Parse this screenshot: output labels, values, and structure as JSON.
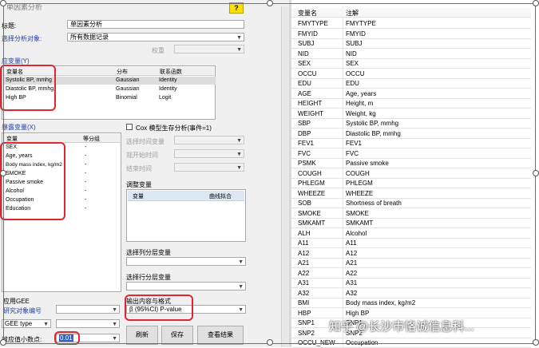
{
  "dialog": {
    "title": "单因素分析",
    "help_label": "?",
    "title_label": "标题:",
    "title_value": "单因素分析",
    "target_label": "选择分析对象:",
    "target_value": "所有数据记录",
    "weight_label": "权重",
    "dependent": {
      "label": "应变量(Y)",
      "headers": [
        "变量名",
        "分布",
        "联系函数"
      ],
      "rows": [
        {
          "name": "Systolic BP, mmhg",
          "dist": "Gaussian",
          "link": "Identity"
        },
        {
          "name": "Diastolic BP, mmhg",
          "dist": "Gaussian",
          "link": "Identity"
        },
        {
          "name": "High BP",
          "dist": "Binomial",
          "link": "Logit"
        }
      ]
    },
    "exposure": {
      "label": "暴露变量(X)",
      "headers": [
        "变量",
        "等分组"
      ],
      "rows": [
        {
          "name": "SEX",
          "grp": "-"
        },
        {
          "name": "Age, years",
          "grp": "-"
        },
        {
          "name": "Body mass index, kg/m2",
          "grp": "-"
        },
        {
          "name": "SMOKE",
          "grp": "-"
        },
        {
          "name": "Passive smoke",
          "grp": "-"
        },
        {
          "name": "Alcohol",
          "grp": "-"
        },
        {
          "name": "Occupation",
          "grp": "-"
        },
        {
          "name": "Education",
          "grp": "-"
        }
      ]
    },
    "cox_label": "Cox 模型生存分析(事件=1)",
    "survival_time_label": "选择时间变量",
    "start_time_label": "观开始时间",
    "end_time_label": "结束时间",
    "adjust": {
      "label": "调整变量",
      "headers": [
        "变量",
        "曲线拟合"
      ]
    },
    "col_strata_label": "选择列分层变量",
    "row_strata_label": "选择行分层变量",
    "gee_label": "应用GEE",
    "gee_id_label": "研究对象编号",
    "gee_type_value": "GEE type",
    "output_label": "输出内容与格式",
    "output_value": "β (95%CI) P-value",
    "decimal_label": "效应值小数点:",
    "decimal_value": "0.01",
    "buttons": {
      "refresh": "刷新",
      "save": "保存",
      "view": "查看结果"
    }
  },
  "variable_table": {
    "headers": [
      "变量名",
      "注解"
    ],
    "rows": [
      [
        "FMYTYPE",
        "FMYTYPE"
      ],
      [
        "FMYID",
        "FMYID"
      ],
      [
        "SUBJ",
        "SUBJ"
      ],
      [
        "NID",
        "NID"
      ],
      [
        "SEX",
        "SEX"
      ],
      [
        "OCCU",
        "OCCU"
      ],
      [
        "EDU",
        "EDU"
      ],
      [
        "AGE",
        "Age, years"
      ],
      [
        "HEIGHT",
        "Height, m"
      ],
      [
        "WEIGHT",
        "Weight, kg"
      ],
      [
        "SBP",
        "Systolic BP, mmhg"
      ],
      [
        "DBP",
        "Diastolic BP, mmhg"
      ],
      [
        "FEV1",
        "FEV1"
      ],
      [
        "FVC",
        "FVC"
      ],
      [
        "PSMK",
        "Passive smoke"
      ],
      [
        "COUGH",
        "COUGH"
      ],
      [
        "PHLEGM",
        "PHLEGM"
      ],
      [
        "WHEEZE",
        "WHEEZE"
      ],
      [
        "SOB",
        "Shortness of breath"
      ],
      [
        "SMOKE",
        "SMOKE"
      ],
      [
        "SMKAMT",
        "SMKAMT"
      ],
      [
        "ALH",
        "Alcohol"
      ],
      [
        "A11",
        "A11"
      ],
      [
        "A12",
        "A12"
      ],
      [
        "A21",
        "A21"
      ],
      [
        "A22",
        "A22"
      ],
      [
        "A31",
        "A31"
      ],
      [
        "A32",
        "A32"
      ],
      [
        "BMI",
        "Body mass index, kg/m2"
      ],
      [
        "HBP",
        "High BP"
      ],
      [
        "SNP1",
        "SNP1"
      ],
      [
        "SNP2",
        "SNP2"
      ],
      [
        "OCCU_NEW",
        "Occupation"
      ]
    ]
  },
  "watermark": "知乎 @长沙市恪诚信息科...",
  "colors": {
    "annotation_red": "#e0262f",
    "help_yellow": "#ffe000"
  }
}
